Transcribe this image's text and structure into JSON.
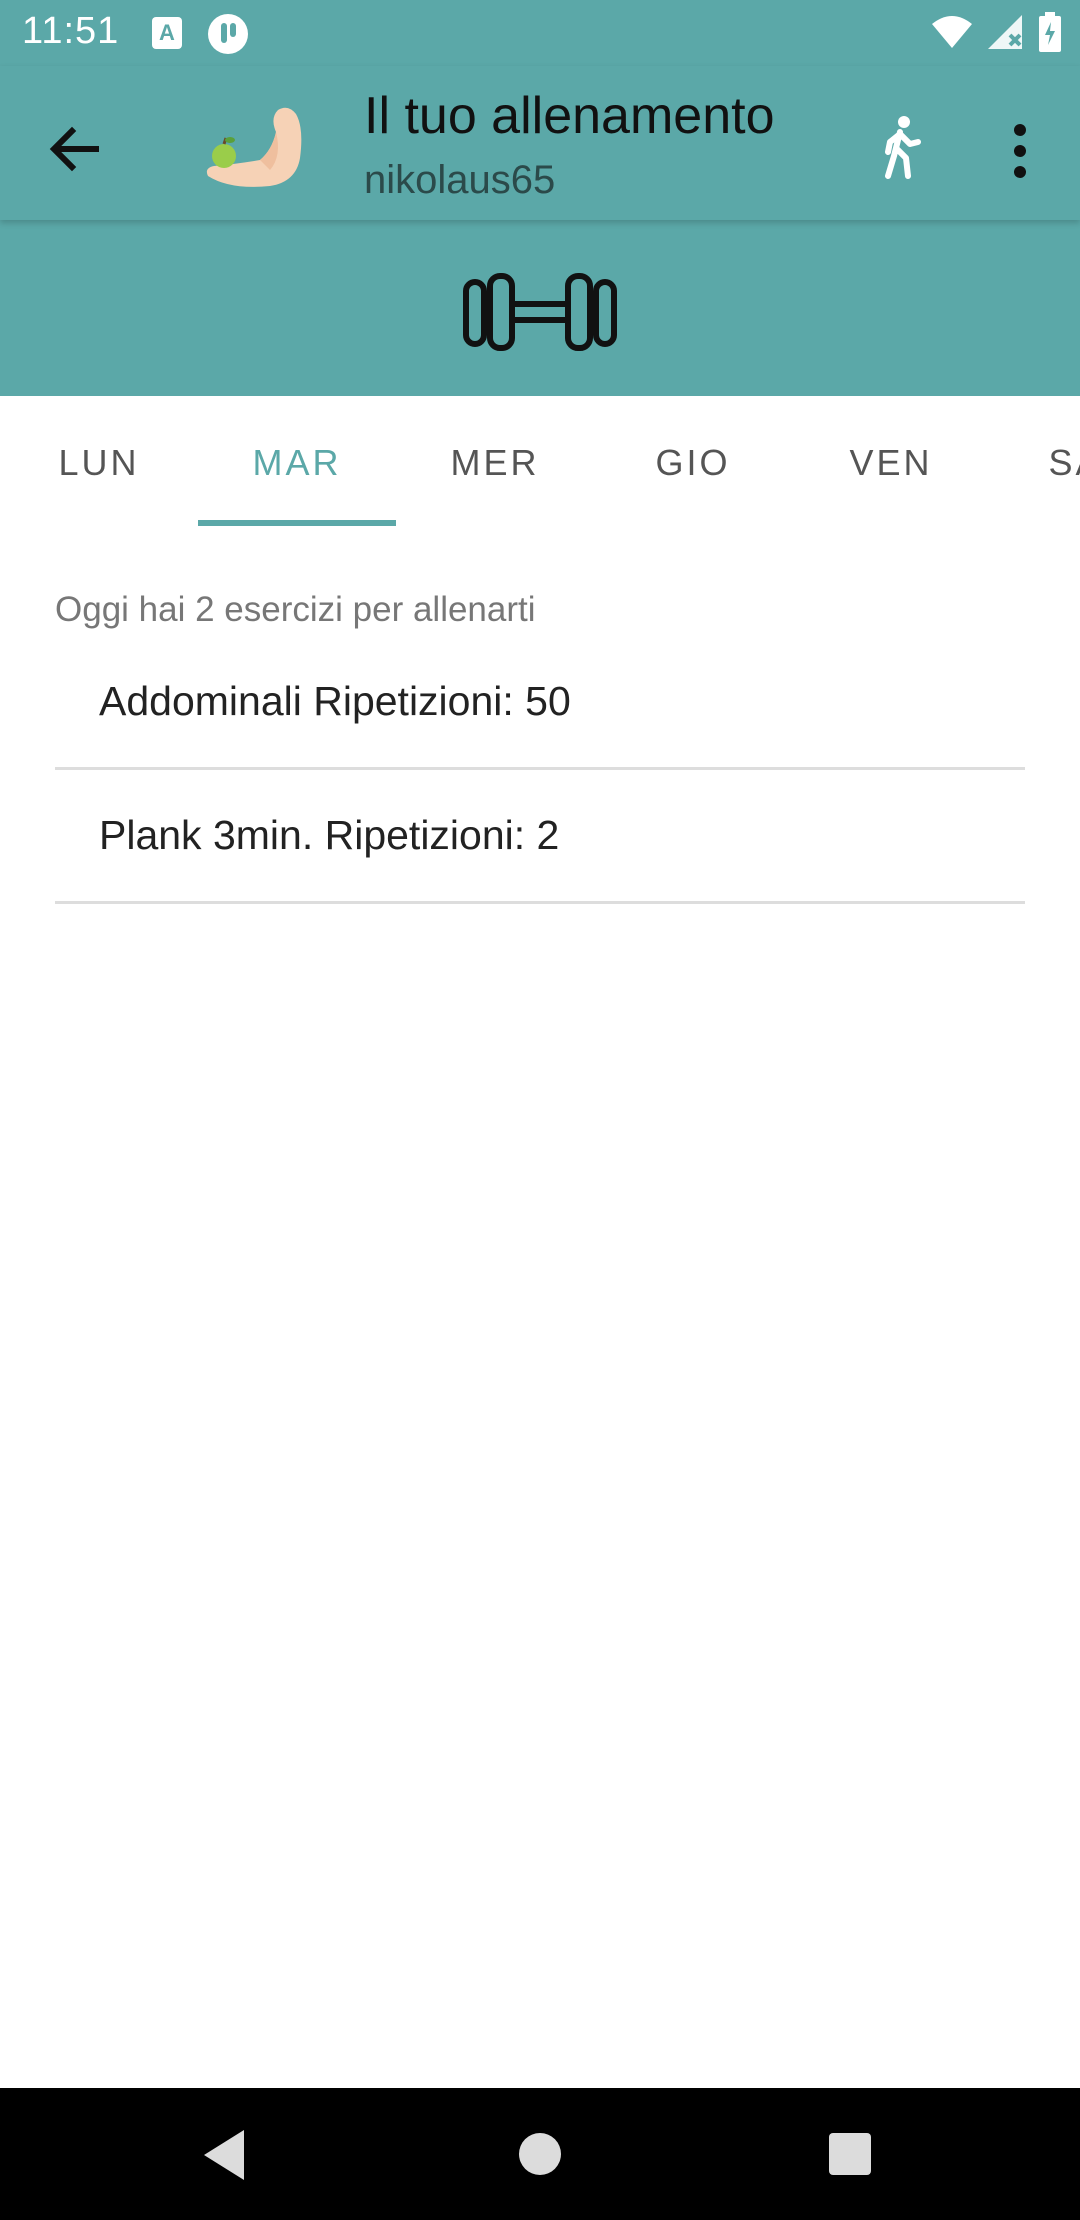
{
  "status_bar": {
    "time": "11:51",
    "notif_a_label": "A"
  },
  "app_bar": {
    "title": "Il tuo allenamento",
    "subtitle": "nikolaus65"
  },
  "tabs": [
    {
      "label": "LUN",
      "active": false
    },
    {
      "label": "MAR",
      "active": true
    },
    {
      "label": "MER",
      "active": false
    },
    {
      "label": "GIO",
      "active": false
    },
    {
      "label": "VEN",
      "active": false
    },
    {
      "label": "SAB",
      "active": false
    }
  ],
  "content": {
    "summary": "Oggi hai 2 esercizi per allenarti",
    "exercises": [
      {
        "text": "Addominali Ripetizioni: 50"
      },
      {
        "text": "Plank 3min. Ripetizioni: 2"
      }
    ]
  },
  "colors": {
    "primary": "#5ba8a8",
    "text": "#222222",
    "secondary_text": "#777777"
  }
}
